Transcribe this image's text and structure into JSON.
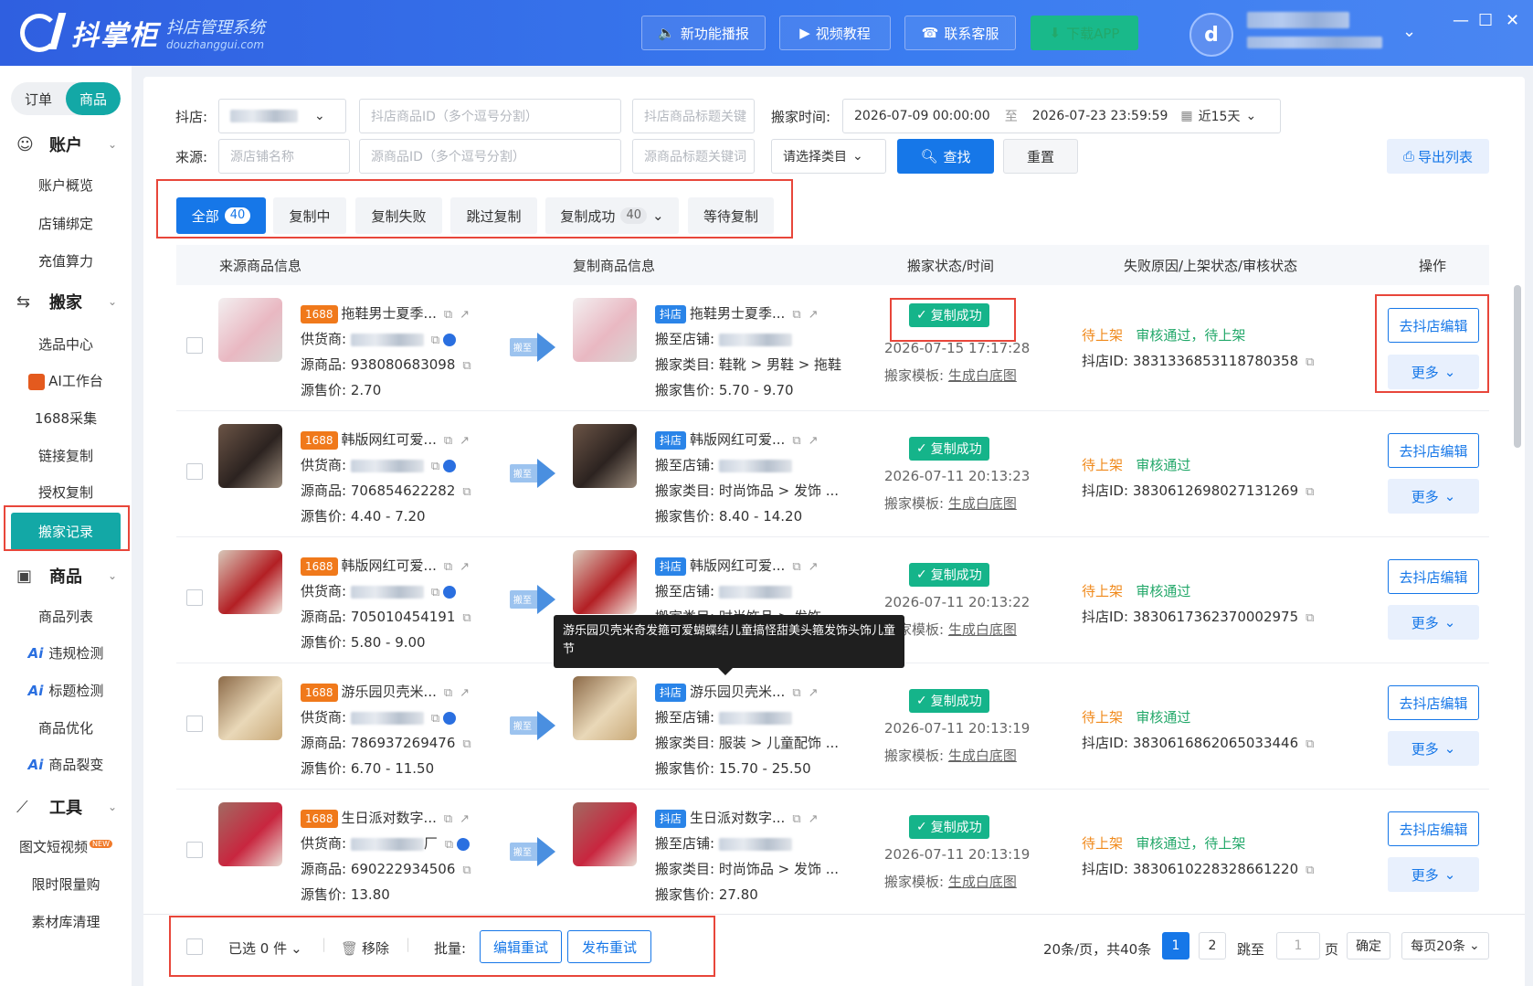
{
  "header": {
    "logo_text": "抖掌柜",
    "logo_sub": "抖店管理系统",
    "logo_domain": "douzhanggui.com",
    "buttons": [
      "新功能播报",
      "视频教程",
      "联系客服",
      "下载APP"
    ],
    "avatar_icon": "logo-avatar"
  },
  "sidebar": {
    "segment": [
      "订单",
      "商品"
    ],
    "groups": [
      {
        "title": "账户",
        "items": [
          "账户概览",
          "店铺绑定",
          "充值算力"
        ]
      },
      {
        "title": "搬家",
        "items": [
          "选品中心",
          "AI工作台",
          "1688采集",
          "链接复制",
          "授权复制",
          "搬家记录"
        ]
      },
      {
        "title": "商品",
        "items": [
          "商品列表",
          "违规检测",
          "标题检测",
          "商品优化",
          "商品裂变"
        ]
      },
      {
        "title": "工具",
        "items": [
          "图文短视频",
          "限时限量购",
          "素材库清理"
        ]
      }
    ],
    "new_badge": "NEW"
  },
  "filters": {
    "shop_label": "抖店:",
    "source_label": "来源:",
    "move_time_label": "搬家时间:",
    "p_shop_id": "抖店商品ID（多个逗号分割）",
    "p_shop_title": "抖店商品标题关键",
    "p_source_shop": "源店铺名称",
    "p_source_id": "源商品ID（多个逗号分割）",
    "p_source_title": "源商品标题关键词",
    "category_select": "请选择类目",
    "date_start": "2026-07-09 00:00:00",
    "date_to": "至",
    "date_end": "2026-07-23 23:59:59",
    "range": "近15天",
    "search": "查找",
    "reset": "重置",
    "export": "导出列表"
  },
  "tabs": [
    {
      "label": "全部",
      "count": "40"
    },
    {
      "label": "复制中"
    },
    {
      "label": "复制失败"
    },
    {
      "label": "跳过复制"
    },
    {
      "label": "复制成功",
      "count": "40"
    },
    {
      "label": "等待复制"
    }
  ],
  "table_headers": [
    "来源商品信息",
    "复制商品信息",
    "搬家状态/时间",
    "失败原因/上架状态/审核状态",
    "操作"
  ],
  "labels": {
    "supplier": "供货商:",
    "source_product": "源商品:",
    "source_price": "源售价:",
    "move_shop": "搬至店铺:",
    "move_category": "搬家类目:",
    "move_price": "搬家售价:",
    "move_template": "搬家模板:",
    "template_link": "生成白底图",
    "shop_id": "抖店ID:",
    "arrow_text": "搬至",
    "tag_1688": "1688",
    "tag_dou": "抖店",
    "status": "复制成功",
    "edit_btn": "去抖店编辑",
    "more_btn": "更多"
  },
  "rows": [
    {
      "title": "拖鞋男士夏季...",
      "source_id": "938080683098",
      "source_price": "2.70",
      "category": "鞋靴 > 男鞋 > 拖鞋",
      "move_price": "5.70 - 9.70",
      "time": "2026-07-15 17:17:28",
      "shelf": "待上架",
      "audit": "审核通过，待上架",
      "shop_id": "3831336853118780358",
      "supplier_suffix": ""
    },
    {
      "title": "韩版网红可爱...",
      "source_id": "706854622282",
      "source_price": "4.40 - 7.20",
      "category": "时尚饰品 > 发饰 ...",
      "move_price": "8.40 - 14.20",
      "time": "2026-07-11 20:13:23",
      "shelf": "待上架",
      "audit": "审核通过",
      "shop_id": "3830612698027131269",
      "supplier_suffix": ""
    },
    {
      "title": "韩版网红可爱...",
      "source_id": "705010454191",
      "source_price": "5.80 - 9.00",
      "category": "时尚饰品 > 发饰 ...",
      "move_price": "",
      "time": "2026-07-11 20:13:22",
      "shelf": "待上架",
      "audit": "审核通过",
      "shop_id": "3830617362370002975",
      "supplier_suffix": ""
    },
    {
      "title": "游乐园贝壳米...",
      "source_id": "786937269476",
      "source_price": "6.70 - 11.50",
      "category": "服装 > 儿童配饰 ...",
      "move_price": "15.70 - 25.50",
      "time": "2026-07-11 20:13:19",
      "shelf": "待上架",
      "audit": "审核通过",
      "shop_id": "3830616862065033446",
      "supplier_suffix": ""
    },
    {
      "title": "生日派对数字...",
      "source_id": "690222934506",
      "source_price": "13.80",
      "category": "时尚饰品 > 发饰 ...",
      "move_price": "27.80",
      "time": "2026-07-11 20:13:19",
      "shelf": "待上架",
      "audit": "审核通过，待上架",
      "shop_id": "3830610228328661220",
      "supplier_suffix": "厂"
    }
  ],
  "tooltip": "游乐园贝壳米奇发箍可爱蝴蝶结儿童搞怪甜美头箍发饰头饰儿童节",
  "footer": {
    "selected": "已选 0 件",
    "remove": "移除",
    "batch": "批量:",
    "edit_retry": "编辑重试",
    "publish_retry": "发布重试",
    "page_info": "20条/页，共40条",
    "pages": [
      "1",
      "2"
    ],
    "jump": "跳至",
    "page_unit": "页",
    "jump_value": "1",
    "confirm": "确定",
    "per_page": "每页20条"
  },
  "colors": {
    "brand": "#2f5fe0",
    "teal": "#13a8a6",
    "primary": "#1677e8",
    "success": "#15b48a",
    "orange": "#f08a1c",
    "red_outline": "#e8463a"
  }
}
